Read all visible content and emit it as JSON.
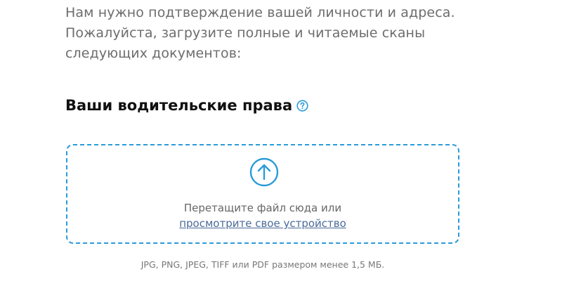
{
  "intro": {
    "text": "Нам нужно подтверждение вашей личности и адреса. Пожалуйста, загрузите полные и читаемые сканы следующих документов:"
  },
  "section": {
    "title": "Ваши водительские права",
    "help_icon": "question-circle-icon"
  },
  "dropzone": {
    "upload_icon": "upload-arrow-icon",
    "drop_text": "Перетащите файл сюда или",
    "browse_link": "просмотрите свое устройство",
    "hint": "JPG, PNG, JPEG, TIFF или PDF размером менее 1,5 МБ."
  },
  "colors": {
    "accent": "#2b9bd8",
    "link": "#4a6a9a"
  }
}
